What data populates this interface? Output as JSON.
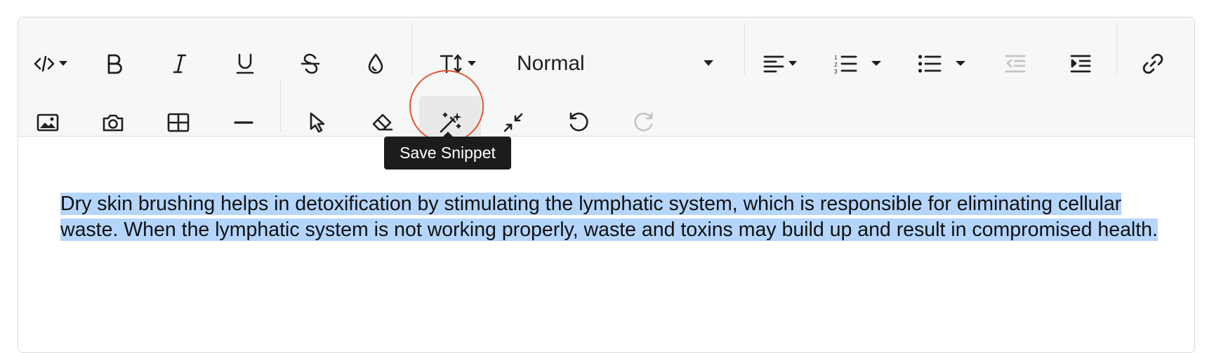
{
  "toolbar": {
    "heading_select": {
      "value": "Normal"
    },
    "tooltip": "Save Snippet",
    "buttons": [
      {
        "name": "code-view-button",
        "icon": "code-icon"
      },
      {
        "name": "bold-button",
        "icon": "bold-icon"
      },
      {
        "name": "italic-button",
        "icon": "italic-icon"
      },
      {
        "name": "underline-button",
        "icon": "underline-icon"
      },
      {
        "name": "strikethrough-button",
        "icon": "strikethrough-icon"
      },
      {
        "name": "text-color-button",
        "icon": "droplet-icon"
      },
      {
        "name": "font-size-button",
        "icon": "text-height-icon"
      },
      {
        "name": "align-button",
        "icon": "align-left-icon"
      },
      {
        "name": "ordered-list-button",
        "icon": "ordered-list-icon"
      },
      {
        "name": "unordered-list-button",
        "icon": "unordered-list-icon"
      },
      {
        "name": "outdent-button",
        "icon": "outdent-icon",
        "disabled": true
      },
      {
        "name": "indent-button",
        "icon": "indent-icon"
      },
      {
        "name": "link-button",
        "icon": "link-icon"
      },
      {
        "name": "insert-image-button",
        "icon": "image-icon"
      },
      {
        "name": "camera-button",
        "icon": "camera-icon"
      },
      {
        "name": "insert-table-button",
        "icon": "table-icon"
      },
      {
        "name": "horizontal-rule-button",
        "icon": "minus-icon"
      },
      {
        "name": "select-button",
        "icon": "pointer-icon"
      },
      {
        "name": "clear-format-button",
        "icon": "eraser-icon"
      },
      {
        "name": "save-snippet-button",
        "icon": "magic-wand-icon",
        "active": true
      },
      {
        "name": "collapse-button",
        "icon": "compress-icon"
      },
      {
        "name": "undo-button",
        "icon": "undo-icon"
      },
      {
        "name": "redo-button",
        "icon": "redo-icon",
        "disabled": true
      }
    ]
  },
  "content": {
    "text": "Dry skin brushing helps in detoxification by stimulating the lymphatic system, which is responsible for eliminating cellular waste. When the lymphatic system is not working properly, waste and toxins may build up and result in compromised health."
  },
  "colors": {
    "toolbar_bg": "#f6f7f7",
    "selection": "#b5d5fb",
    "highlight_ring": "#e05530",
    "tooltip_bg": "#1c1c1c",
    "disabled_icon": "#c4c4c4"
  }
}
